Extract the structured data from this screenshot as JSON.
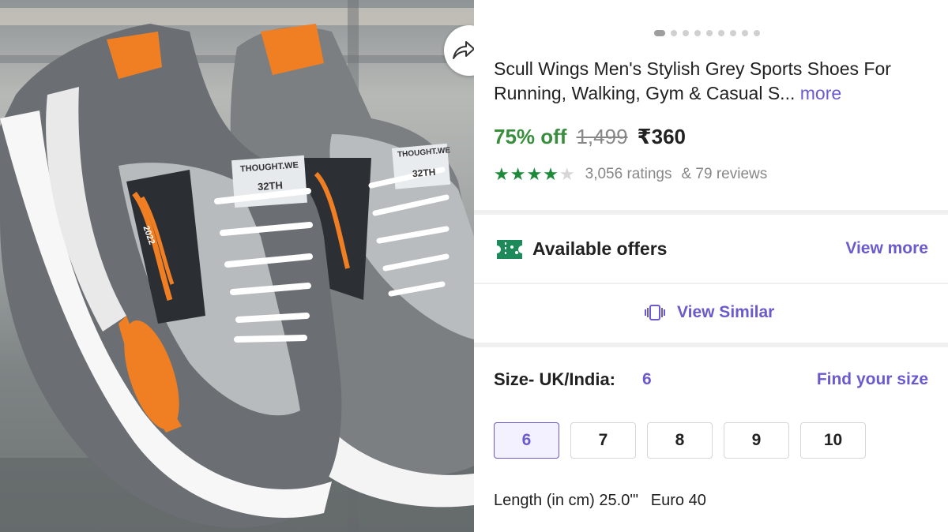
{
  "product": {
    "title": "Scull Wings Men's Stylish Grey Sports Shoes For Running, Walking, Gym & Casual S...",
    "more_link": "more",
    "discount": "75% off",
    "mrp": "1,499",
    "price": "₹360",
    "rating_stars": 4,
    "ratings_text": "3,056 ratings",
    "reviews_text": "& 79 reviews",
    "carousel": {
      "total": 9,
      "active": 0
    }
  },
  "shoe_labels": {
    "tag_line1": "THOUGHT.WE",
    "tag_line2": "32TH",
    "stripe_text": "2022"
  },
  "offers": {
    "icon": "ticket-icon",
    "label": "Available offers",
    "view_more": "View more"
  },
  "similar": {
    "icon": "similar-icon",
    "label": "View Similar"
  },
  "size": {
    "label": "Size- UK/India:",
    "selected_value": "6",
    "find_size": "Find your size",
    "options": [
      "6",
      "7",
      "8",
      "9",
      "10"
    ]
  },
  "length": {
    "cm": "Length (in cm) 25.0\"'",
    "euro": "Euro 40"
  },
  "colors": {
    "accent": "#6a5acd",
    "discount_green": "#388e3c",
    "star_green": "#1d8a3a",
    "shoe_orange": "#f07f24"
  },
  "icons": {
    "share": "share-icon"
  }
}
